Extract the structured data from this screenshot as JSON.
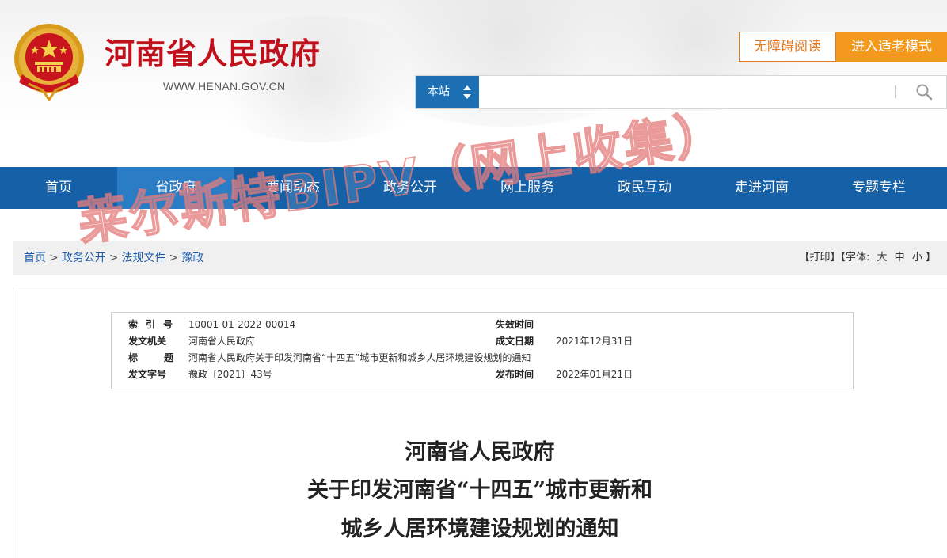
{
  "header": {
    "site_title": "河南省人民政府",
    "site_url": "WWW.HENAN.GOV.CN",
    "accessibility_button": "无障碍阅读",
    "elder_mode_button": "进入适老模式"
  },
  "search": {
    "scope": "本站",
    "placeholder": ""
  },
  "nav": {
    "items": [
      {
        "label": "首页"
      },
      {
        "label": "省政府"
      },
      {
        "label": "要闻动态"
      },
      {
        "label": "政务公开"
      },
      {
        "label": "网上服务"
      },
      {
        "label": "政民互动"
      },
      {
        "label": "走进河南"
      },
      {
        "label": "专题专栏"
      }
    ],
    "active_index": 1
  },
  "breadcrumb": {
    "items": [
      "首页",
      "政务公开",
      "法规文件",
      "豫政"
    ],
    "separator": ">"
  },
  "tools": {
    "print": "【打印】",
    "font_label": "【字体:",
    "font_large": "大",
    "font_medium": "中",
    "font_small": "小",
    "font_close": "】"
  },
  "meta": {
    "index_label": "索引号",
    "index_value": "10001-01-2022-00014",
    "expire_label": "失效时间",
    "expire_value": "",
    "issuer_label": "发文机关",
    "issuer_value": "河南省人民政府",
    "created_label": "成文日期",
    "created_value": "2021年12月31日",
    "title_label": "标题",
    "title_value": "河南省人民政府关于印发河南省“十四五”城市更新和城乡人居环境建设规划的通知",
    "docno_label": "发文字号",
    "docno_value": "豫政〔2021〕43号",
    "published_label": "发布时间",
    "published_value": "2022年01月21日"
  },
  "document": {
    "title_line1": "河南省人民政府",
    "title_line2": "关于印发河南省“十四五”城市更新和",
    "title_line3": "城乡人居环境建设规划的通知"
  },
  "watermark": {
    "text": "莱尔斯特BIPV（网上收集）"
  },
  "colors": {
    "brand_red": "#c0101c",
    "nav_blue": "#1560a6",
    "nav_active": "#2a7cc4",
    "accent_orange": "#f39a1e"
  }
}
